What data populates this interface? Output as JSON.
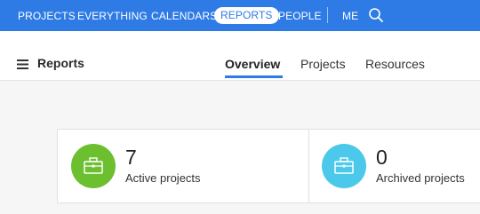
{
  "nav": {
    "items": [
      {
        "label": "PROJECTS"
      },
      {
        "label": "EVERYTHING"
      },
      {
        "label": "CALENDARS"
      },
      {
        "label": "REPORTS"
      },
      {
        "label": "PEOPLE"
      },
      {
        "label": "ME"
      }
    ],
    "active": "REPORTS",
    "search_icon": "search-icon"
  },
  "header": {
    "title": "Reports",
    "menu_icon": "hamburger-menu-icon",
    "tabs": [
      {
        "label": "Overview"
      },
      {
        "label": "Projects"
      },
      {
        "label": "Resources"
      }
    ],
    "active_tab": "Overview"
  },
  "stats": [
    {
      "count": "7",
      "label": "Active projects",
      "icon": "briefcase-icon",
      "color": "#6cbf2f"
    },
    {
      "count": "0",
      "label": "Archived projects",
      "icon": "briefcase-icon",
      "color": "#4cc8ea"
    }
  ],
  "colors": {
    "accent": "#2f7be5",
    "active_green": "#6cbf2f",
    "archived_blue": "#4cc8ea"
  }
}
